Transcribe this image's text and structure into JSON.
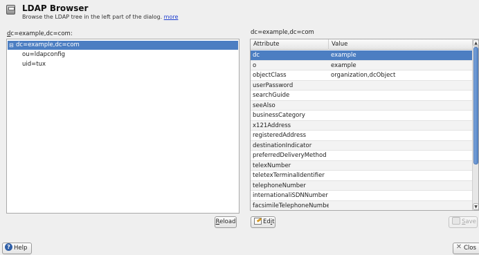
{
  "header": {
    "title": "LDAP Browser",
    "subtitle": "Browse the LDAP tree in the left part of the dialog.",
    "more_link": "more"
  },
  "tree": {
    "label_underlined": "d",
    "label_rest": "c=example,dc=com:",
    "nodes": [
      {
        "label": "dc=example,dc=com",
        "selected": true,
        "expander": "⊟"
      },
      {
        "label": "ou=ldapconfig"
      },
      {
        "label": "uid=tux"
      }
    ]
  },
  "table": {
    "title": "dc=example,dc=com",
    "headers": {
      "attribute": "Attribute",
      "value": "Value"
    },
    "rows": [
      {
        "attribute": "dc",
        "value": "example",
        "selected": true
      },
      {
        "attribute": "o",
        "value": "example"
      },
      {
        "attribute": "objectClass",
        "value": "organization,dcObject"
      },
      {
        "attribute": "userPassword",
        "value": ""
      },
      {
        "attribute": "searchGuide",
        "value": ""
      },
      {
        "attribute": "seeAlso",
        "value": ""
      },
      {
        "attribute": "businessCategory",
        "value": ""
      },
      {
        "attribute": "x121Address",
        "value": ""
      },
      {
        "attribute": "registeredAddress",
        "value": ""
      },
      {
        "attribute": "destinationIndicator",
        "value": ""
      },
      {
        "attribute": "preferredDeliveryMethod",
        "value": ""
      },
      {
        "attribute": "telexNumber",
        "value": ""
      },
      {
        "attribute": "teletexTerminalIdentifier",
        "value": ""
      },
      {
        "attribute": "telephoneNumber",
        "value": ""
      },
      {
        "attribute": "internationaliSDNNumber",
        "value": ""
      },
      {
        "attribute": "facsimileTelephoneNumber",
        "value": ""
      }
    ]
  },
  "buttons": {
    "reload_u": "R",
    "reload_rest": "eload",
    "edit_pre": "Ed",
    "edit_u": "i",
    "edit_rest": "t",
    "save_u": "S",
    "save_rest": "ave",
    "help": "Help",
    "close": "Clos"
  },
  "colors": {
    "selection": "#4c7ec2",
    "link": "#1a3bd0",
    "window_bg": "#efefef"
  },
  "icons": {
    "app": "ldap-browser-icon",
    "edit": "edit-icon",
    "save": "save-icon",
    "help": "help-icon",
    "close": "close-icon"
  }
}
